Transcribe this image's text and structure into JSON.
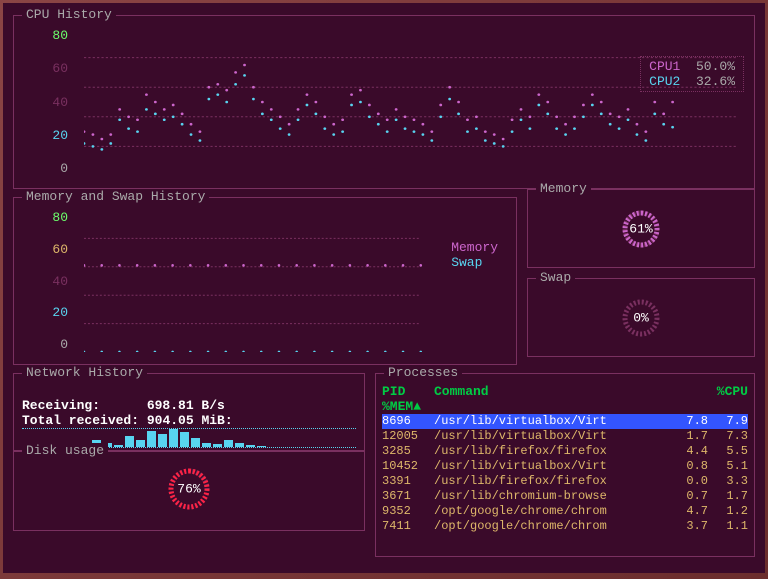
{
  "cpu_panel": {
    "title": "CPU History",
    "yticks": [
      "80",
      "60",
      "40",
      "20",
      "0"
    ],
    "legend": [
      {
        "name": "CPU1",
        "value": "50.0%"
      },
      {
        "name": "CPU2",
        "value": "32.6%"
      }
    ]
  },
  "mem_panel": {
    "title": "Memory and Swap History",
    "yticks": [
      "80",
      "60",
      "40",
      "20",
      "0"
    ],
    "legend": [
      {
        "name": "Memory"
      },
      {
        "name": "Swap"
      }
    ]
  },
  "memory_box": {
    "title": "Memory",
    "value": "61%",
    "pct": 61
  },
  "swap_box": {
    "title": "Swap",
    "value": "0%",
    "pct": 0
  },
  "network": {
    "title": "Network History",
    "receiving_label": "Receiving:",
    "receiving_value": "698.81  B/s",
    "total_label": "Total received:",
    "total_value": "904.05 MiB:"
  },
  "disk": {
    "title": "Disk usage",
    "value": "76%",
    "pct": 76
  },
  "processes": {
    "title": "Processes",
    "headers": {
      "pid": "PID",
      "command": "Command",
      "cpu": "%CPU"
    },
    "sort": "%MEM▲",
    "rows": [
      {
        "pid": "8696",
        "cmd": "/usr/lib/virtualbox/Virt",
        "cpu": "7.8",
        "mem": "7.9",
        "sel": true
      },
      {
        "pid": "12005",
        "cmd": "/usr/lib/virtualbox/Virt",
        "cpu": "1.7",
        "mem": "7.3"
      },
      {
        "pid": "3285",
        "cmd": "/usr/lib/firefox/firefox",
        "cpu": "4.4",
        "mem": "5.5"
      },
      {
        "pid": "10452",
        "cmd": "/usr/lib/virtualbox/Virt",
        "cpu": "0.8",
        "mem": "5.1"
      },
      {
        "pid": "3391",
        "cmd": "/usr/lib/firefox/firefox",
        "cpu": "0.0",
        "mem": "3.3"
      },
      {
        "pid": "3671",
        "cmd": "/usr/lib/chromium-browse",
        "cpu": "0.7",
        "mem": "1.7"
      },
      {
        "pid": "9352",
        "cmd": "/opt/google/chrome/chrom",
        "cpu": "4.7",
        "mem": "1.2"
      },
      {
        "pid": "7411",
        "cmd": "/opt/google/chrome/chrom",
        "cpu": "3.7",
        "mem": "1.1"
      }
    ]
  },
  "chart_data": [
    {
      "type": "line",
      "title": "CPU History",
      "ylabel": "%",
      "ylim": [
        0,
        100
      ],
      "series": [
        {
          "name": "CPU1",
          "values": [
            30,
            28,
            25,
            28,
            45,
            40,
            38,
            55,
            50,
            45,
            48,
            42,
            35,
            30,
            60,
            62,
            58,
            70,
            75,
            60,
            50,
            45,
            40,
            35,
            45,
            55,
            50,
            40,
            35,
            38,
            55,
            58,
            48,
            42,
            38,
            45,
            40,
            38,
            35,
            30,
            48,
            60,
            50,
            38,
            40,
            30,
            28,
            25,
            38,
            45,
            40,
            55,
            50,
            40,
            35,
            40,
            48,
            55,
            50,
            42,
            40,
            45,
            35,
            30,
            50,
            42,
            50
          ]
        },
        {
          "name": "CPU2",
          "values": [
            22,
            20,
            18,
            22,
            38,
            32,
            30,
            45,
            42,
            38,
            40,
            35,
            28,
            24,
            52,
            55,
            50,
            62,
            68,
            52,
            42,
            38,
            32,
            28,
            38,
            48,
            42,
            32,
            28,
            30,
            48,
            50,
            40,
            35,
            30,
            38,
            32,
            30,
            28,
            24,
            40,
            52,
            42,
            30,
            32,
            24,
            22,
            20,
            30,
            38,
            32,
            48,
            42,
            32,
            28,
            32,
            40,
            48,
            42,
            35,
            32,
            38,
            28,
            24,
            42,
            35,
            33
          ]
        }
      ]
    },
    {
      "type": "line",
      "title": "Memory and Swap History",
      "ylabel": "%",
      "ylim": [
        0,
        100
      ],
      "series": [
        {
          "name": "Memory",
          "values": [
            61,
            61,
            61,
            61,
            61,
            61,
            61,
            61,
            61,
            61,
            61,
            61,
            61,
            61,
            61,
            61,
            61,
            61,
            61,
            61
          ]
        },
        {
          "name": "Swap",
          "values": [
            0,
            0,
            0,
            0,
            0,
            0,
            0,
            0,
            0,
            0,
            0,
            0,
            0,
            0,
            0,
            0,
            0,
            0,
            0,
            0
          ]
        }
      ]
    },
    {
      "type": "bar",
      "title": "Network History",
      "ylabel": "B/s",
      "series": [
        {
          "name": "Receiving",
          "values": [
            300,
            200,
            100,
            500,
            300,
            700,
            600,
            800,
            650,
            400,
            200,
            150,
            300,
            200,
            100,
            50
          ]
        }
      ]
    }
  ]
}
